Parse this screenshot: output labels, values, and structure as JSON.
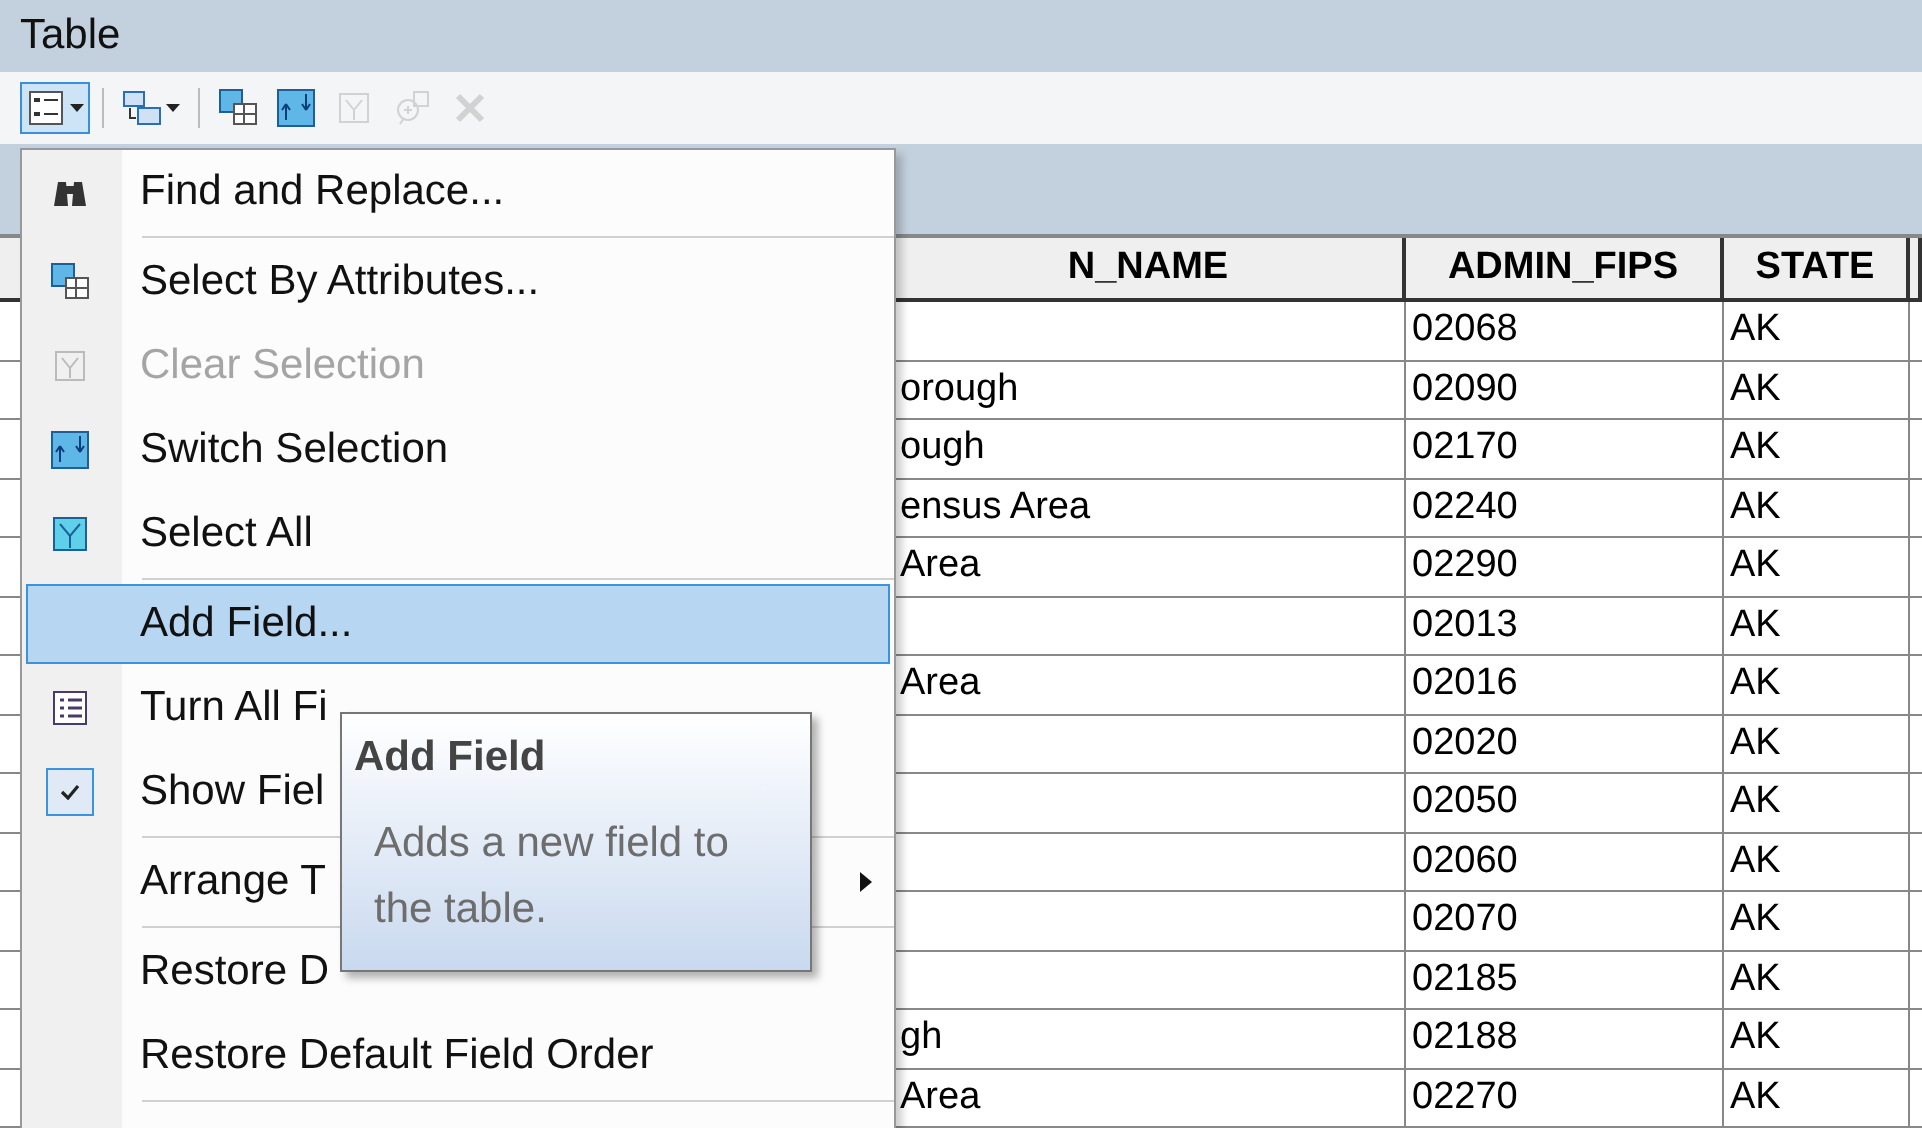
{
  "window": {
    "title": "Table"
  },
  "toolbar": {
    "buttons": [
      {
        "kind": "options",
        "disabled": false,
        "pressed": true
      },
      {
        "kind": "related",
        "disabled": false,
        "pressed": false
      },
      {
        "kind": "select-attr",
        "disabled": false,
        "pressed": false
      },
      {
        "kind": "switch",
        "disabled": false,
        "pressed": false
      },
      {
        "kind": "clear",
        "disabled": true,
        "pressed": false
      },
      {
        "kind": "zoom",
        "disabled": true,
        "pressed": false
      },
      {
        "kind": "delete",
        "disabled": true,
        "pressed": false
      }
    ]
  },
  "table": {
    "columns": [
      "N_NAME",
      "ADMIN_FIPS",
      "STATE"
    ],
    "rows": [
      {
        "name": null,
        "admin_fips": "02068",
        "state": "AK"
      },
      {
        "name": "orough",
        "admin_fips": "02090",
        "state": "AK"
      },
      {
        "name": "ough",
        "admin_fips": "02170",
        "state": "AK"
      },
      {
        "name": "ensus Area",
        "admin_fips": "02240",
        "state": "AK"
      },
      {
        "name": "Area",
        "admin_fips": "02290",
        "state": "AK"
      },
      {
        "name": null,
        "admin_fips": "02013",
        "state": "AK"
      },
      {
        "name": "Area",
        "admin_fips": "02016",
        "state": "AK"
      },
      {
        "name": null,
        "admin_fips": "02020",
        "state": "AK"
      },
      {
        "name": null,
        "admin_fips": "02050",
        "state": "AK"
      },
      {
        "name": null,
        "admin_fips": "02060",
        "state": "AK"
      },
      {
        "name": null,
        "admin_fips": "02070",
        "state": "AK"
      },
      {
        "name": null,
        "admin_fips": "02185",
        "state": "AK"
      },
      {
        "name": "gh",
        "admin_fips": "02188",
        "state": "AK"
      },
      {
        "name": "Area",
        "admin_fips": "02270",
        "state": "AK"
      }
    ]
  },
  "menu": {
    "items": [
      {
        "label": "Find and Replace...",
        "kind": "icon",
        "disabled": false,
        "selected": false,
        "separator_after": true
      },
      {
        "label": "Select By Attributes...",
        "kind": "icon",
        "disabled": false,
        "selected": false,
        "separator_after": false
      },
      {
        "label": "Clear Selection",
        "kind": "icon",
        "disabled": true,
        "selected": false,
        "separator_after": false
      },
      {
        "label": "Switch Selection",
        "kind": "icon",
        "disabled": false,
        "selected": false,
        "separator_after": false
      },
      {
        "label": "Select All",
        "kind": "icon",
        "disabled": false,
        "selected": false,
        "separator_after": true
      },
      {
        "label": "Add Field...",
        "kind": "plain",
        "disabled": false,
        "selected": true,
        "separator_after": false
      },
      {
        "label": "Turn All Fi",
        "kind": "icon",
        "disabled": false,
        "selected": false,
        "separator_after": false
      },
      {
        "label": "Show Fiel",
        "kind": "check",
        "checked": true,
        "disabled": false,
        "selected": false,
        "separator_after": true
      },
      {
        "label": "Arrange T",
        "kind": "submenu",
        "disabled": false,
        "selected": false,
        "separator_after": true
      },
      {
        "label": "Restore D",
        "kind": "plain",
        "disabled": false,
        "selected": false,
        "separator_after": false
      },
      {
        "label": "Restore Default Field Order",
        "kind": "plain",
        "disabled": false,
        "selected": false,
        "separator_after": true
      }
    ]
  },
  "tooltip": {
    "title": "Add Field",
    "text": "Adds a new field to the table."
  }
}
